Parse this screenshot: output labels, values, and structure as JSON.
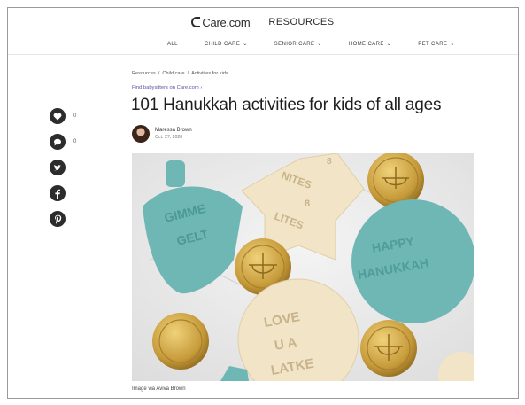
{
  "brand": {
    "logo_text": "Care.com",
    "section": "RESOURCES"
  },
  "nav": {
    "items": [
      {
        "label": "ALL"
      },
      {
        "label": "CHILD CARE"
      },
      {
        "label": "SENIOR CARE"
      },
      {
        "label": "HOME CARE"
      },
      {
        "label": "PET CARE"
      }
    ],
    "chevron": "⌄"
  },
  "share": [
    {
      "icon": "heart-icon",
      "count": "0"
    },
    {
      "icon": "comment-icon",
      "count": "0"
    },
    {
      "icon": "twitter-icon"
    },
    {
      "icon": "facebook-icon"
    },
    {
      "icon": "pinterest-icon"
    }
  ],
  "breadcrumb": [
    "Resources",
    "Child care",
    "Activities for kids"
  ],
  "breadcrumb_sep": "/",
  "find_link": "Find babysitters on Care.com ›",
  "article": {
    "title": "101 Hanukkah activities for kids of all ages",
    "author": "Maressa Brown",
    "date": "Oct. 27, 2020",
    "image_caption": "Image via Aviva Brown"
  },
  "photo_text": {
    "dreidel": [
      "GIMME",
      "GELT"
    ],
    "star": [
      "8",
      "NITES",
      "8",
      "LITES"
    ],
    "happy": [
      "HAPPY",
      "HANUKKAH"
    ],
    "latke": [
      "LOVE",
      "U A",
      "LATKE"
    ]
  },
  "colors": {
    "accent_link": "#5b4fa6",
    "cookie_blue": "#6fb7b4",
    "cookie_cream": "#f2e4c6",
    "gold": "#c9a24a"
  }
}
